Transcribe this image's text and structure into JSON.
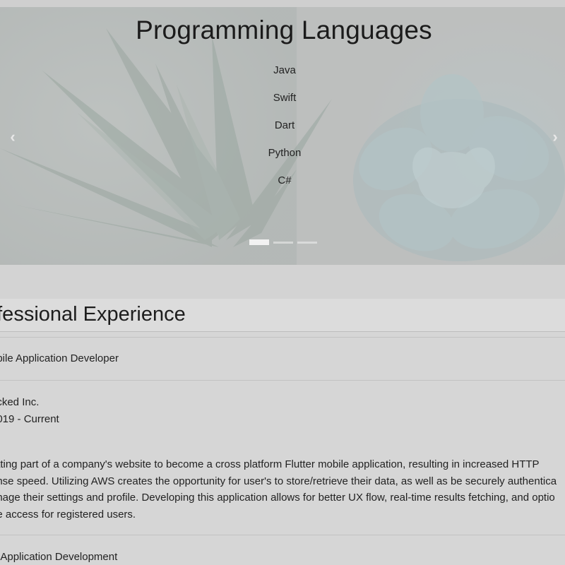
{
  "carousel": {
    "title": "Programming Languages",
    "languages": [
      "Java",
      "Swift",
      "Dart",
      "Python",
      "C#"
    ],
    "prev_icon": "chevron-left-icon",
    "next_icon": "chevron-right-icon",
    "slide_count": 3,
    "active_slide": 1
  },
  "experience": {
    "heading": "ofessional Experience",
    "job1": {
      "title": "obile Application Developer",
      "company": "acked Inc.",
      "dates": "2019 - Current",
      "description_lines": [
        "rating part of a company's website to become a cross platform Flutter mobile application, resulting in increased HTTP",
        "onse speed. Utilizing AWS creates the opportunity for user's to store/retrieve their data, as well as be securely authentica",
        "anage their settings and profile. Developing this application allows for better UX flow, real-time results fetching, and optio",
        "ne access for registered users."
      ]
    },
    "job2": {
      "title": "S Application Development"
    }
  }
}
